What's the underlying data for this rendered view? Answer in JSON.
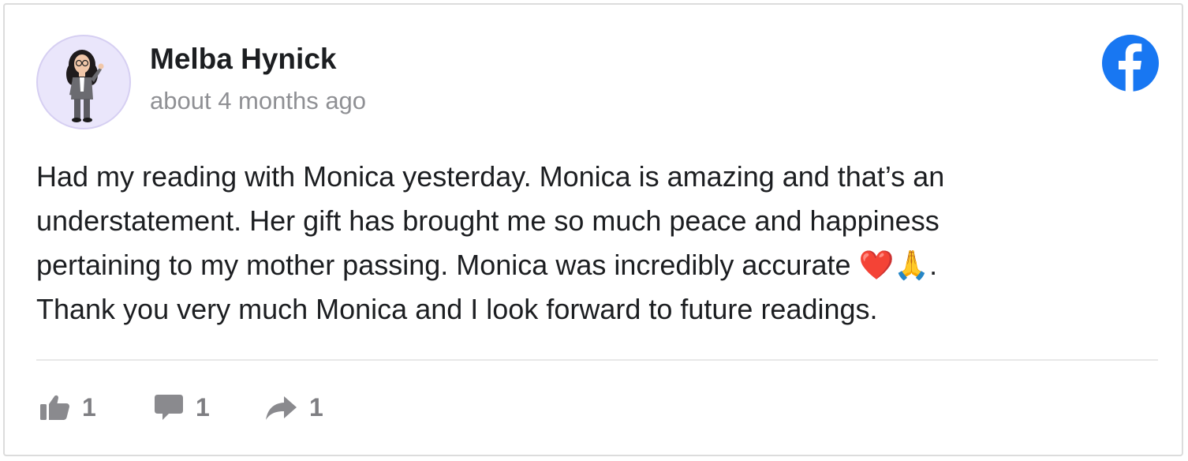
{
  "post": {
    "author": "Melba Hynick",
    "timestamp": "about 4 months ago",
    "source_icon": "facebook-logo-icon",
    "body_lines": [
      "Had my reading with Monica yesterday. Monica is amazing and that’s an",
      "understatement. Her gift has brought me so much peace and happiness",
      "pertaining to my mother passing. Monica was incredibly accurate ❤️🙏.",
      "Thank you very much Monica and I look forward to future readings."
    ]
  },
  "actions": {
    "like": {
      "icon": "thumbs-up-icon",
      "count": "1"
    },
    "comment": {
      "icon": "comment-icon",
      "count": "1"
    },
    "share": {
      "icon": "share-arrow-icon",
      "count": "1"
    }
  },
  "colors": {
    "facebook_blue": "#1877f2",
    "text": "#1c1e21",
    "muted": "#8f9094",
    "action_icon": "#8a8a8e"
  }
}
